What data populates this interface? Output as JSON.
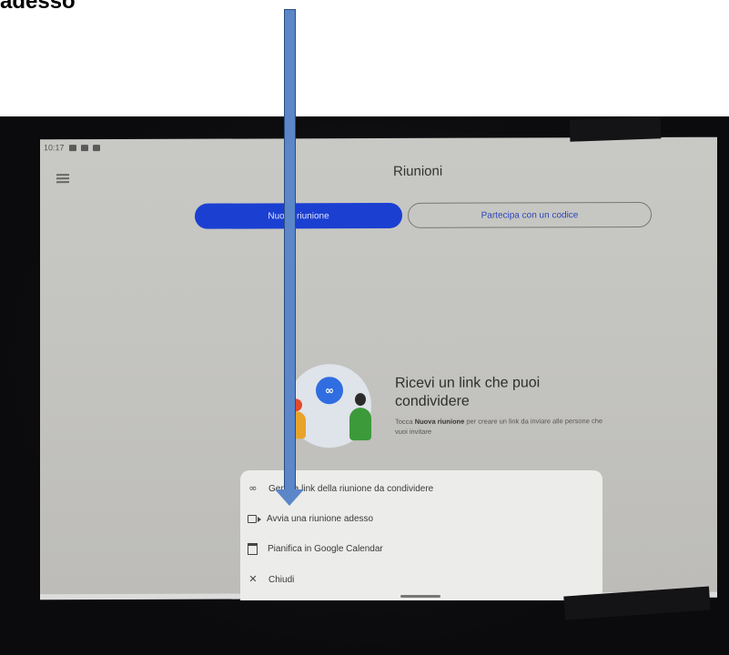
{
  "caption": "adesso",
  "status_bar": {
    "time": "10:17"
  },
  "app": {
    "title": "Riunioni",
    "new_meeting_label": "Nuova riunione",
    "join_code_label": "Partecipa con un codice",
    "info_title": "Ricevi un link che puoi condividere",
    "info_text_pre": "Tocca ",
    "info_text_bold": "Nuova riunione",
    "info_text_post": " per creare un link da inviare alle persone che vuoi invitare"
  },
  "sheet": {
    "items": [
      {
        "label": "Genera link della riunione da condividere",
        "icon": "link-icon"
      },
      {
        "label": "Avvia una riunione adesso",
        "icon": "video-camera-icon"
      },
      {
        "label": "Pianifica in Google Calendar",
        "icon": "calendar-icon"
      },
      {
        "label": "Chiudi",
        "icon": "close-icon"
      }
    ]
  },
  "colors": {
    "accent": "#1b3fd1",
    "arrow": "#5b86c8",
    "sheet_bg": "#ececea"
  }
}
